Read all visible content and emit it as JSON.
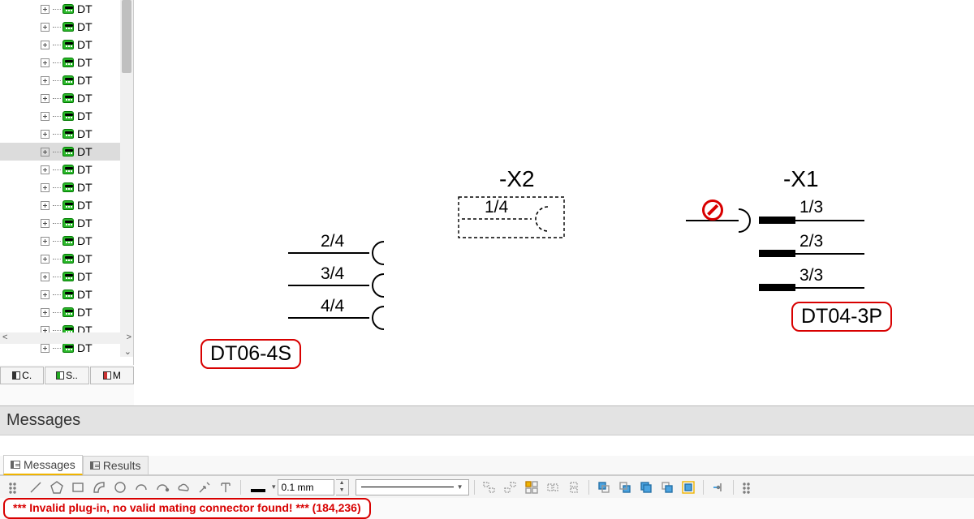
{
  "tree": {
    "item_label": "DT",
    "count": 20,
    "selected_index": 8
  },
  "tree_tabs": [
    "C.",
    "S..",
    "M"
  ],
  "canvas": {
    "x2": {
      "name": "-X2",
      "pin": "1/4",
      "part_label": "DT06-4S"
    },
    "x2_pins_below": [
      "2/4",
      "3/4",
      "4/4"
    ],
    "x1": {
      "name": "-X1",
      "pins": [
        "1/3",
        "2/3",
        "3/3"
      ],
      "part_label": "DT04-3P"
    }
  },
  "messages": {
    "title": "Messages",
    "tabs": [
      "Messages",
      "Results"
    ],
    "active_tab": 0
  },
  "toolbar": {
    "line_width": "0.1 mm"
  },
  "error": "*** Invalid plug-in, no valid mating connector found! *** (184,236)"
}
